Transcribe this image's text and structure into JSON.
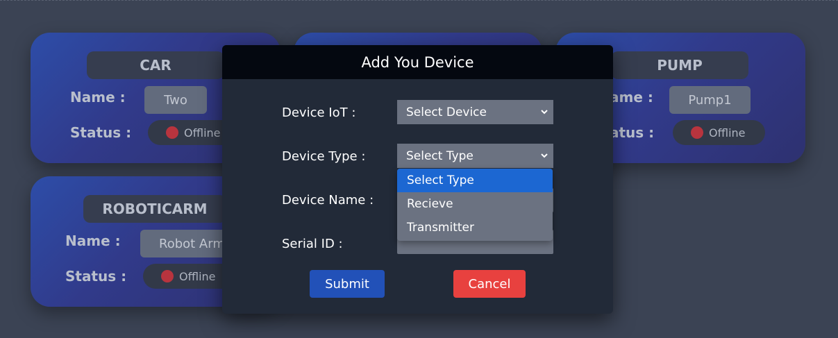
{
  "cards": [
    {
      "title": "CAR",
      "name_label": "Name :",
      "name_value": "Two",
      "status_label": "Status :",
      "status_value": "Offline"
    },
    {
      "title": "PUMP",
      "name_label": "ame :",
      "name_value": "Pump1",
      "status_label": "atus :",
      "status_value": "Offline"
    },
    {
      "title": "ROBOTICARM",
      "name_label": "Name :",
      "name_value": "Robot Arm",
      "status_label": "Status :",
      "status_value": "Offline"
    }
  ],
  "modal": {
    "title": "Add You Device",
    "fields": {
      "device_iot": {
        "label": "Device IoT :",
        "value": "Select Device"
      },
      "device_type": {
        "label": "Device Type :",
        "value": "Select Type"
      },
      "device_name": {
        "label": "Device Name :"
      },
      "serial_id": {
        "label": "Serial ID :"
      }
    },
    "type_options": [
      "Select Type",
      "Recieve",
      "Transmitter"
    ],
    "submit_label": "Submit",
    "cancel_label": "Cancel"
  },
  "colors": {
    "primary": "#2251b8",
    "danger": "#e8413f",
    "selected_option": "#1c67d2",
    "offline": "#b8343e"
  }
}
